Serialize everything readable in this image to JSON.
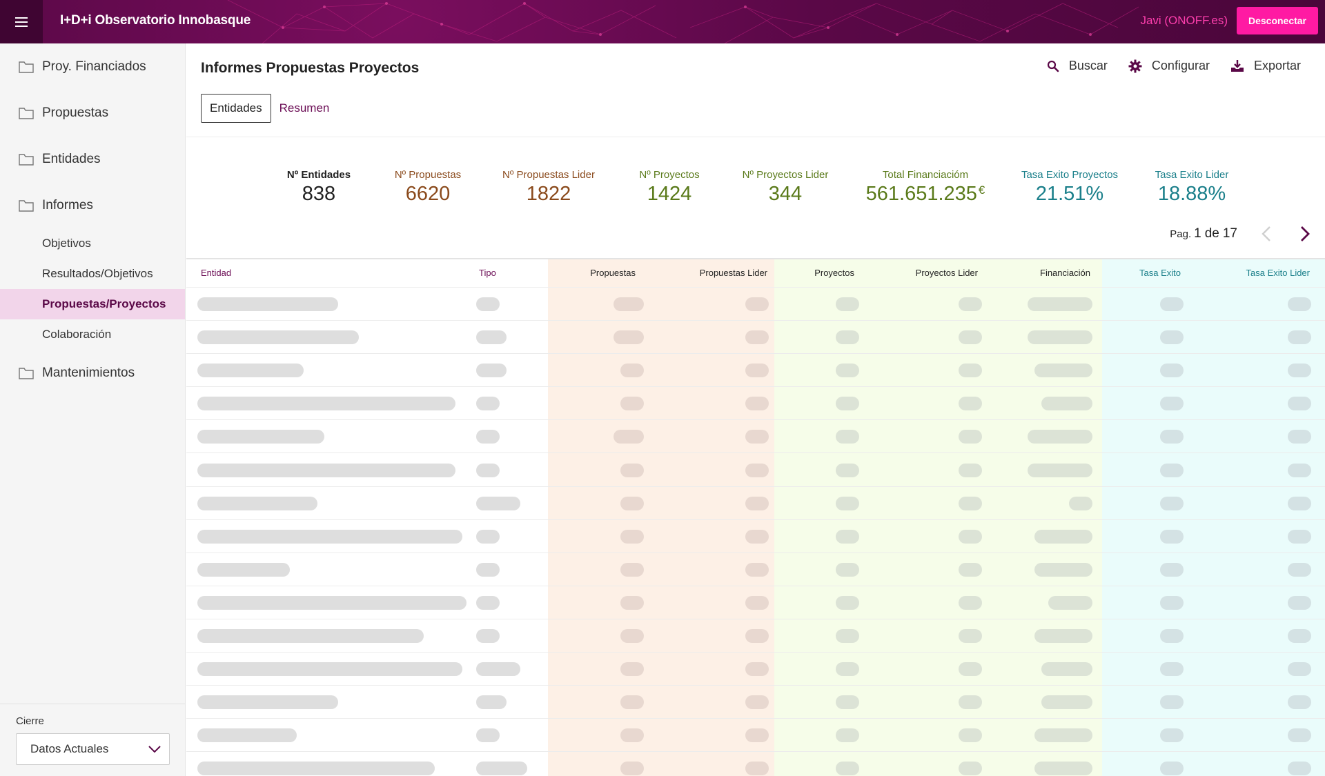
{
  "header": {
    "app_title": "I+D+i Observatorio Innobasque",
    "user": "Javi (ONOFF.es)",
    "logout_label": "Desconectar"
  },
  "sidebar": {
    "folders": [
      {
        "label": "Proy. Financiados"
      },
      {
        "label": "Propuestas"
      },
      {
        "label": "Entidades"
      },
      {
        "label": "Informes"
      },
      {
        "label": "Mantenimientos"
      }
    ],
    "sub_items": [
      {
        "label": "Objetivos",
        "active": false
      },
      {
        "label": "Resultados/Objetivos",
        "active": false
      },
      {
        "label": "Propuestas/Proyectos",
        "active": true
      },
      {
        "label": "Colaboración",
        "active": false
      }
    ],
    "cierre_label": "Cierre",
    "cierre_value": "Datos Actuales"
  },
  "main": {
    "title": "Informes Propuestas Proyectos",
    "toolbar": {
      "search_label": "Buscar",
      "config_label": "Configurar",
      "export_label": "Exportar"
    },
    "tabs": [
      {
        "label": "Entidades",
        "active": true
      },
      {
        "label": "Resumen",
        "active": false
      }
    ]
  },
  "stats": [
    {
      "label": "Nº Entidades",
      "value": "838",
      "color": "#222222"
    },
    {
      "label": "Nº Propuestas",
      "value": "6620",
      "color": "#8a4a1c"
    },
    {
      "label": "Nº Propuestas Lider",
      "value": "1822",
      "color": "#8a4a1c"
    },
    {
      "label": "Nº Proyectos",
      "value": "1424",
      "color": "#5a7a1a"
    },
    {
      "label": "Nº Proyectos Lider",
      "value": "344",
      "color": "#5a7a1a"
    },
    {
      "label": "Total Financiacióm",
      "value": "561.651.235",
      "suffix": "€",
      "color": "#5a7a1a"
    },
    {
      "label": "Tasa Exito Proyectos",
      "value": "21.51%",
      "color": "#1a7f8a"
    },
    {
      "label": "Tasa Exito Lider",
      "value": "18.88%",
      "color": "#1a7f8a"
    }
  ],
  "pager": {
    "label": "Pag.",
    "current": "1",
    "sep": "de",
    "total": "17"
  },
  "table": {
    "columns": [
      {
        "label": "Entidad",
        "color": "#6b0d55"
      },
      {
        "label": "Tipo",
        "color": "#6b0d55"
      },
      {
        "label": "Propuestas",
        "color": "#222222"
      },
      {
        "label": "Propuestas Lider",
        "color": "#222222"
      },
      {
        "label": "Proyectos",
        "color": "#222222"
      },
      {
        "label": "Proyectos Lider",
        "color": "#222222"
      },
      {
        "label": "Financiación",
        "color": "#222222"
      },
      {
        "label": "Tasa Exito",
        "color": "#1a7f8a"
      },
      {
        "label": "Tasa Exito Lider",
        "color": "#1a7f8a"
      }
    ],
    "group_colors": {
      "propuestas_bg": "#fdf0e6",
      "proyectos_bg": "#f6fde9",
      "tasa_bg": "#eafcfb",
      "pill_default": "#dedede",
      "pill_propuestas": "#e8d8d0",
      "pill_proyectos": "#dce3d6",
      "pill_tasa": "#d4e2e4"
    },
    "loading_rows": 15
  },
  "colors": {
    "brand": "#5a0847",
    "accent": "#ff1aa3"
  }
}
